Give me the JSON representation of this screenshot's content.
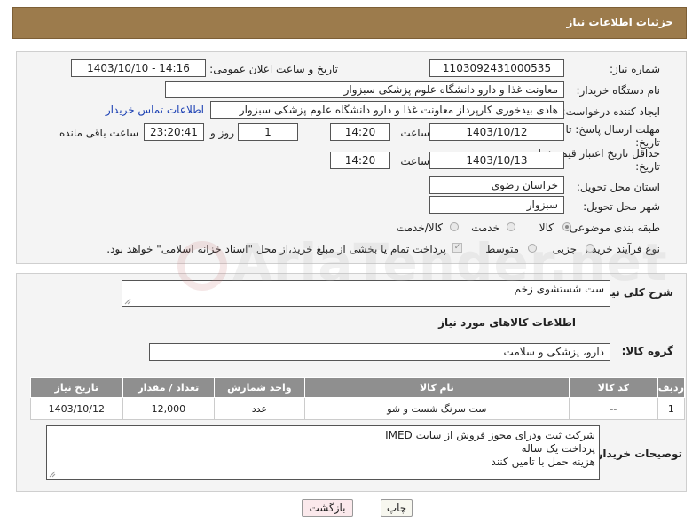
{
  "page_title": "جزئیات اطلاعات نیاز",
  "fields": {
    "need_number_label": "شماره نیاز:",
    "need_number": "1103092431000535",
    "announce_label": "تاریخ و ساعت اعلان عمومی:",
    "announce_value": "1403/10/10 - 14:16",
    "buyer_org_label": "نام دستگاه خریدار:",
    "buyer_org": "معاونت غذا و دارو   دانشگاه علوم پزشکی سبزوار",
    "creator_label": "ایجاد کننده درخواست:",
    "creator": "هادی بیدخوری کارپرداز معاونت غذا و دارو   دانشگاه علوم پزشکی سبزوار",
    "contact_link": "اطلاعات تماس خریدار",
    "deadline_label": "مهلت ارسال پاسخ: تا تاریخ:",
    "deadline_date": "1403/10/12",
    "time_label": "ساعت",
    "deadline_time": "14:20",
    "days_value": "1",
    "days_label": "روز و",
    "remaining_time": "23:20:41",
    "remaining_label": "ساعت باقی مانده",
    "validity_label": "حداقل تاریخ اعتبار قیمت: تا تاریخ:",
    "validity_date": "1403/10/13",
    "validity_time": "14:20",
    "province_label": "استان محل تحویل:",
    "province": "خراسان رضوی",
    "city_label": "شهر محل تحویل:",
    "city": "سبزوار",
    "category_label": "طبقه بندی موضوعی:",
    "category_options": [
      "کالا",
      "خدمت",
      "کالا/خدمت"
    ],
    "category_selected": "کالا",
    "process_label": "نوع فرآیند خرید :",
    "process_options": [
      "جزیی",
      "متوسط"
    ],
    "payment_note": "پرداخت تمام یا بخشی از مبلغ خرید،از محل \"اسناد خزانه اسلامی\" خواهد بود."
  },
  "summary_label": "شرح کلی نیاز:",
  "summary_value": "ست شستشوی زخم",
  "goods_section_title": "اطلاعات کالاهای مورد نیاز",
  "goods_group_label": "گروه کالا:",
  "goods_group": "دارو، پزشکی و سلامت",
  "table": {
    "headers": [
      "ردیف",
      "کد کالا",
      "نام کالا",
      "واحد شمارش",
      "تعداد / مقدار",
      "تاریخ نیاز"
    ],
    "rows": [
      [
        "1",
        "--",
        "ست سرنگ شست و شو",
        "عدد",
        "12,000",
        "1403/10/12"
      ]
    ]
  },
  "buyer_notes_label": "توضیحات خریدار:",
  "buyer_notes_lines": [
    "شرکت ثبت ودرای مجوز فروش از سایت IMED",
    "پرداخت یک ساله",
    "هزینه حمل با تامین کنند"
  ],
  "buttons": {
    "print": "چاپ",
    "back": "بازگشت"
  },
  "watermark": "AriaTender.net",
  "colors": {
    "title_bar": "#9c7b4c",
    "table_header": "#8f8f8f",
    "link": "#1a3fb3"
  }
}
